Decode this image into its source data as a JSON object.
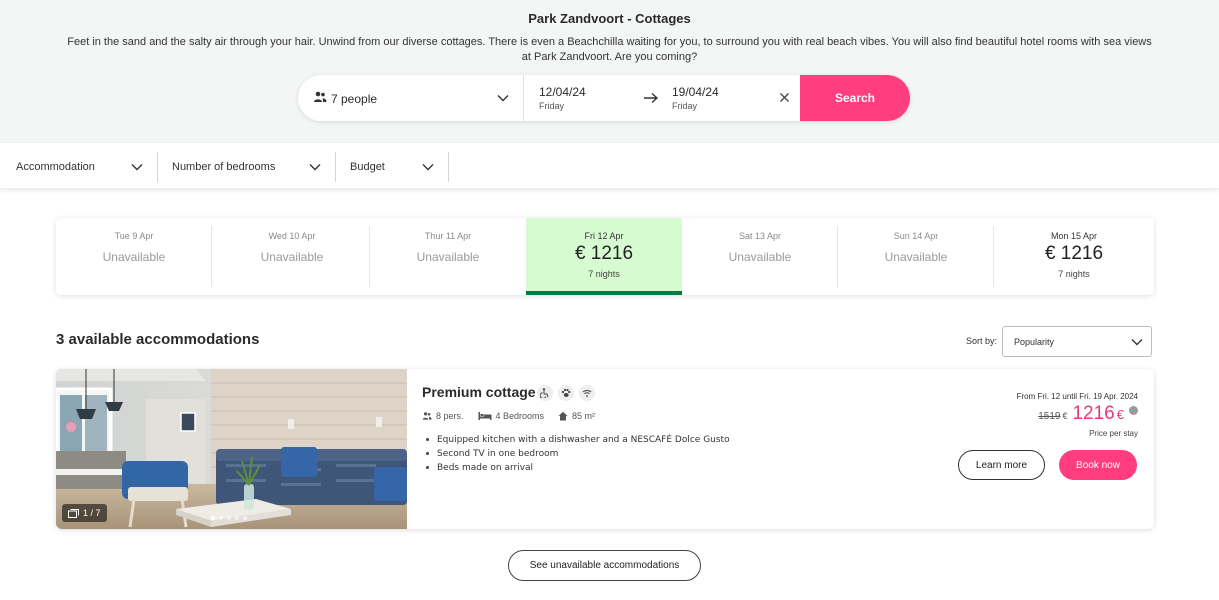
{
  "hero": {
    "title": "Park Zandvoort - Cottages",
    "description": "Feet in the sand and the salty air through your hair. Unwind from our diverse cottages. There is even a Beachchilla waiting for you, to surround you with real beach vibes. You will also find beautiful hotel rooms with sea views at Park Zandvoort. Are you coming?"
  },
  "search": {
    "people": "7 people",
    "start_date": "12/04/24",
    "start_day": "Friday",
    "end_date": "19/04/24",
    "end_day": "Friday",
    "button": "Search"
  },
  "filters": [
    {
      "label": "Accommodation"
    },
    {
      "label": "Number of bedrooms"
    },
    {
      "label": "Budget"
    }
  ],
  "days": [
    {
      "name": "Tue 9 Apr",
      "status": "Unavailable"
    },
    {
      "name": "Wed 10 Apr",
      "status": "Unavailable"
    },
    {
      "name": "Thur 11 Apr",
      "status": "Unavailable"
    },
    {
      "name": "Fri 12 Apr",
      "price": "€ 1216",
      "nights": "7 nights",
      "selected": true
    },
    {
      "name": "Sat 13 Apr",
      "status": "Unavailable"
    },
    {
      "name": "Sun 14 Apr",
      "status": "Unavailable"
    },
    {
      "name": "Mon 15 Apr",
      "price": "€ 1216",
      "nights": "7 nights"
    }
  ],
  "results": {
    "title": "3 available accommodations",
    "sort_label": "Sort by:",
    "sort_value": "Popularity"
  },
  "card": {
    "name": "Premium cottage",
    "features": [
      "wheelchair-icon",
      "pet-icon",
      "wifi-icon"
    ],
    "persons": "8 pers.",
    "bedrooms": "4 Bedrooms",
    "area": "85 m²",
    "bullets": [
      "Equipped kitchen with a dishwasher and a NESCAFÉ Dolce Gusto",
      "Second TV in one bedroom",
      "Beds made on arrival"
    ],
    "photo_counter": "1 / 7",
    "photo_total": 7,
    "period": "From Fri. 12 until Fri. 19 Apr. 2024",
    "old_price": "1519",
    "old_currency": "€",
    "new_price": "1216",
    "new_currency": "€",
    "price_note": "Price per stay",
    "learn_more": "Learn more",
    "book_now": "Book now"
  },
  "see_unavailable": "See unavailable accommodations",
  "colors": {
    "accent": "#ff3d7f",
    "price": "#e5397a",
    "selected_bg": "#d7fbd1",
    "selected_bar": "#047a48",
    "hero_bg": "#f3f6f4"
  }
}
